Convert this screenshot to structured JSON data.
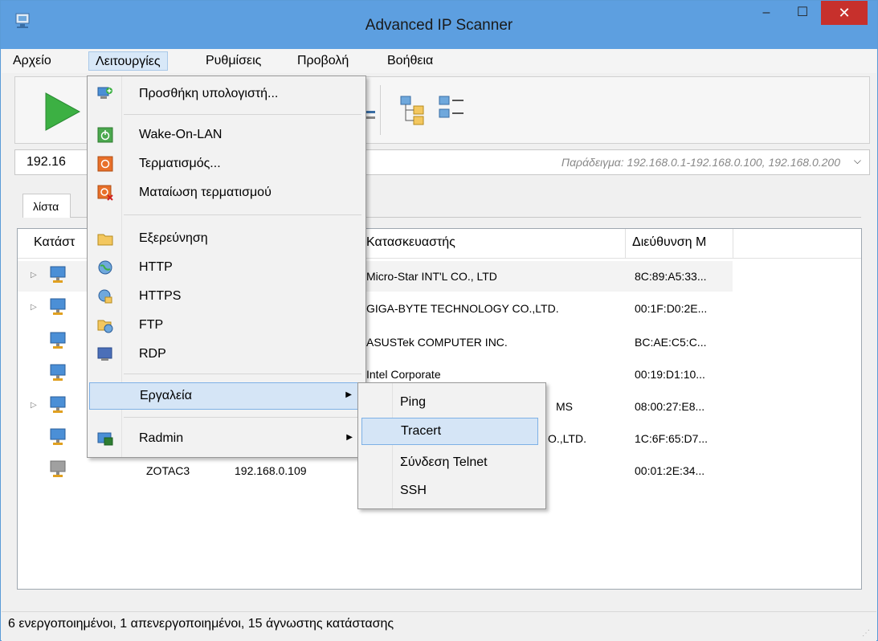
{
  "window": {
    "title": "Advanced IP Scanner",
    "minimize_glyph": "–",
    "maximize_glyph": "☐",
    "close_glyph": "✕"
  },
  "menubar": {
    "items": [
      {
        "label": "Αρχείο"
      },
      {
        "label": "Λειτουργίες"
      },
      {
        "label": "Ρυθμίσεις"
      },
      {
        "label": "Προβολή"
      },
      {
        "label": "Βοήθεια"
      }
    ]
  },
  "range": {
    "value": "192.16",
    "hint": "Παράδειγμα: 192.168.0.1-192.168.0.100, 192.168.0.200"
  },
  "tabs": {
    "first_label": "λίστα απ"
  },
  "list": {
    "headers": {
      "status": "Κατάστ",
      "manufacturer": "Κατασκευαστής",
      "mac": "Διεύθυνση Μ"
    },
    "rows": [
      {
        "manufacturer": "Micro-Star INT'L CO., LTD",
        "mac": "8C:89:A5:33..."
      },
      {
        "manufacturer": "GIGA-BYTE TECHNOLOGY CO.,LTD.",
        "mac": "00:1F:D0:2E..."
      },
      {
        "manufacturer": "ASUSTek COMPUTER INC.",
        "mac": "BC:AE:C5:C..."
      },
      {
        "manufacturer": "Intel Corporate",
        "mac": "00:19:D1:10..."
      },
      {
        "manufacturer": "MS",
        "mac": "08:00:27:E8..."
      },
      {
        "manufacturer": "O.,LTD.",
        "mac": "1C:6F:65:D7..."
      },
      {
        "name": "ZOTAC3",
        "ip": "192.168.0.109",
        "mac": "00:01:2E:34..."
      }
    ]
  },
  "dropdown": {
    "items": [
      {
        "label": "Προσθήκη υπολογιστή..."
      },
      {
        "label": "Wake-On-LAN"
      },
      {
        "label": "Τερματισμός..."
      },
      {
        "label": "Ματαίωση τερματισμού"
      },
      {
        "label": "Εξερεύνηση"
      },
      {
        "label": "HTTP"
      },
      {
        "label": "HTTPS"
      },
      {
        "label": "FTP"
      },
      {
        "label": "RDP"
      },
      {
        "label": "Εργαλεία"
      },
      {
        "label": "Radmin"
      }
    ]
  },
  "submenu": {
    "items": [
      {
        "label": "Ping"
      },
      {
        "label": "Tracert"
      },
      {
        "label": "Σύνδεση Telnet"
      },
      {
        "label": "SSH"
      }
    ]
  },
  "status": {
    "text": "6 ενεργοποιημένοι, 1 απενεργοποιημένοι, 15 άγνωστης κατάστασης"
  },
  "colors": {
    "titlebar": "#5d9fe0",
    "close_button": "#c7302c",
    "menu_highlight": "#d5e5f6",
    "play_green": "#3cb043"
  }
}
